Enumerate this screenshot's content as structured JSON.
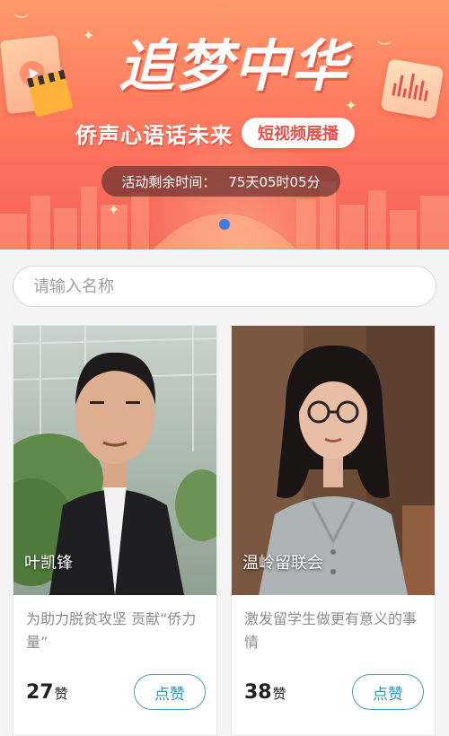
{
  "banner": {
    "title_art": "追梦中华",
    "subtitle": "侨声心语话未来",
    "tag": "短视频展播",
    "countdown_label": "活动剩余时间：",
    "countdown_value": "75天05时05分",
    "carousel_active_index": 0,
    "colors": {
      "top": "#ff9a6c",
      "bottom": "#f5605a",
      "dot": "#3d7de0"
    }
  },
  "search": {
    "placeholder": "请输入名称",
    "value": ""
  },
  "cards": [
    {
      "name": "叶凯锋",
      "description": "为助力脱贫攻坚 贡献“侨力量”",
      "likes": "27",
      "likes_unit": "赞",
      "like_button": "点赞"
    },
    {
      "name": "温岭留联会",
      "description": "激发留学生做更有意义的事情",
      "likes": "38",
      "likes_unit": "赞",
      "like_button": "点赞"
    }
  ],
  "icons": [
    "play-icon",
    "clapperboard-icon",
    "audio-wave-icon",
    "sparkle-icon",
    "bird-icon"
  ],
  "accent_color": "#3a8fb5"
}
